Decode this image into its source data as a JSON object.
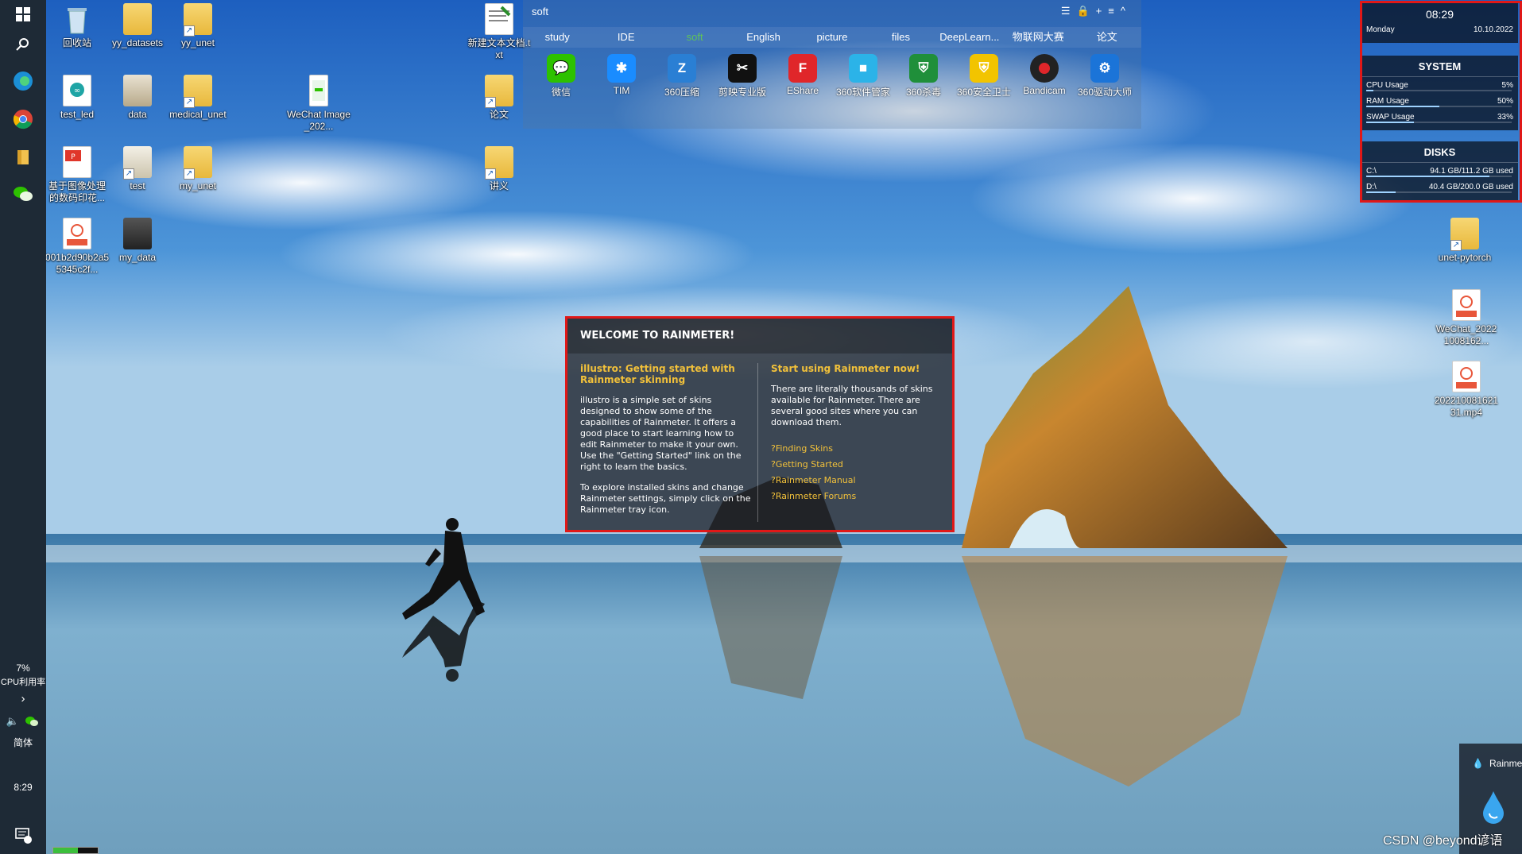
{
  "taskbar": {
    "icons": [
      "windows-start-icon",
      "search-icon",
      "edge-icon",
      "chrome-icon",
      "file-explorer-icon",
      "wechat-icon"
    ],
    "cpu_percent": "7%",
    "cpu_label": "CPU利用率",
    "ime": "简体",
    "clock": "8:29",
    "notification_badge": "1"
  },
  "desktop_icons": [
    {
      "label": "回收站",
      "kind": "recycle"
    },
    {
      "label": "yy_datasets",
      "kind": "folder"
    },
    {
      "label": "yy_unet",
      "kind": "folder-shortcut"
    },
    {
      "label": "新建文本文档.txt",
      "kind": "txt"
    },
    {
      "label": "test_led",
      "kind": "app"
    },
    {
      "label": "data",
      "kind": "folder"
    },
    {
      "label": "medical_unet",
      "kind": "folder-shortcut"
    },
    {
      "label": "WeChat Image_202...",
      "kind": "image"
    },
    {
      "label": "论文",
      "kind": "folder-shortcut"
    },
    {
      "label": "基于图像处理的数码印花...",
      "kind": "pdf"
    },
    {
      "label": "test",
      "kind": "folder-shortcut"
    },
    {
      "label": "my_unet",
      "kind": "folder-shortcut"
    },
    {
      "label": "讲义",
      "kind": "folder-shortcut"
    },
    {
      "label": "001b2d90b2a55345c2f...",
      "kind": "mp4"
    },
    {
      "label": "my_data",
      "kind": "folder"
    },
    {
      "label": "unet-pytorch",
      "kind": "folder-shortcut"
    },
    {
      "label": "WeChat_20221008162...",
      "kind": "mp4"
    },
    {
      "label": "20221008162131.mp4",
      "kind": "mp4"
    }
  ],
  "fence": {
    "title": "soft",
    "tabs": [
      "study",
      "IDE",
      "soft",
      "English",
      "picture",
      "files",
      "DeepLearn...",
      "物联网大赛",
      "论文"
    ],
    "active_tab": "soft",
    "apps": [
      {
        "label": "微信",
        "color": "#2dc100",
        "glyph": "W"
      },
      {
        "label": "TIM",
        "color": "#1a8cff",
        "glyph": "✱"
      },
      {
        "label": "360压缩",
        "color": "#2a7fd4",
        "glyph": "Z"
      },
      {
        "label": "剪映专业版",
        "color": "#111111",
        "glyph": "✂"
      },
      {
        "label": "EShare",
        "color": "#e0262a",
        "glyph": "F"
      },
      {
        "label": "360软件管家",
        "color": "#2bb3e8",
        "glyph": "■"
      },
      {
        "label": "360杀毒",
        "color": "#1f8f3a",
        "glyph": "⛨"
      },
      {
        "label": "360安全卫士",
        "color": "#f2c400",
        "glyph": "⛨"
      },
      {
        "label": "Bandicam",
        "color": "#222222",
        "glyph": "●"
      },
      {
        "label": "360驱动大师",
        "color": "#1b74d8",
        "glyph": "⚙"
      }
    ]
  },
  "rainmeter_clock": {
    "time": "08:29",
    "day": "Monday",
    "date": "10.10.2022"
  },
  "rainmeter_system": {
    "title": "SYSTEM",
    "rows": [
      {
        "label": "CPU Usage",
        "value": "5%",
        "level": 0.05
      },
      {
        "label": "RAM Usage",
        "value": "50%",
        "level": 0.5
      },
      {
        "label": "SWAP Usage",
        "value": "33%",
        "level": 0.33
      }
    ]
  },
  "rainmeter_disks": {
    "title": "DISKS",
    "rows": [
      {
        "label": "C:\\",
        "value": "94.1 GB/111.2 GB used",
        "level": 0.846
      },
      {
        "label": "D:\\",
        "value": "40.4 GB/200.0 GB used",
        "level": 0.202
      }
    ]
  },
  "welcome": {
    "title": "WELCOME TO RAINMETER!",
    "left_heading": "illustro: Getting started with Rainmeter skinning",
    "left_p1": "illustro is a simple set of skins designed to show some of the capabilities of Rainmeter. It offers a good place to start learning how to edit Rainmeter to make it your own. Use the \"Getting Started\" link on the right to learn the basics.",
    "left_p2": "To explore installed skins and change Rainmeter settings, simply click on the Rainmeter tray icon.",
    "right_heading": "Start using Rainmeter now!",
    "right_p1": "There are literally thousands of skins available for Rainmeter. There are several good sites where you can download them.",
    "links": [
      "?Finding Skins",
      "?Getting Started",
      "?Rainmeter Manual",
      "?Rainmeter Forums"
    ]
  },
  "rainmeter_tray": {
    "label": "Rainme"
  },
  "watermark": "CSDN @beyond谚语",
  "progress": {
    "level": 0.55
  }
}
